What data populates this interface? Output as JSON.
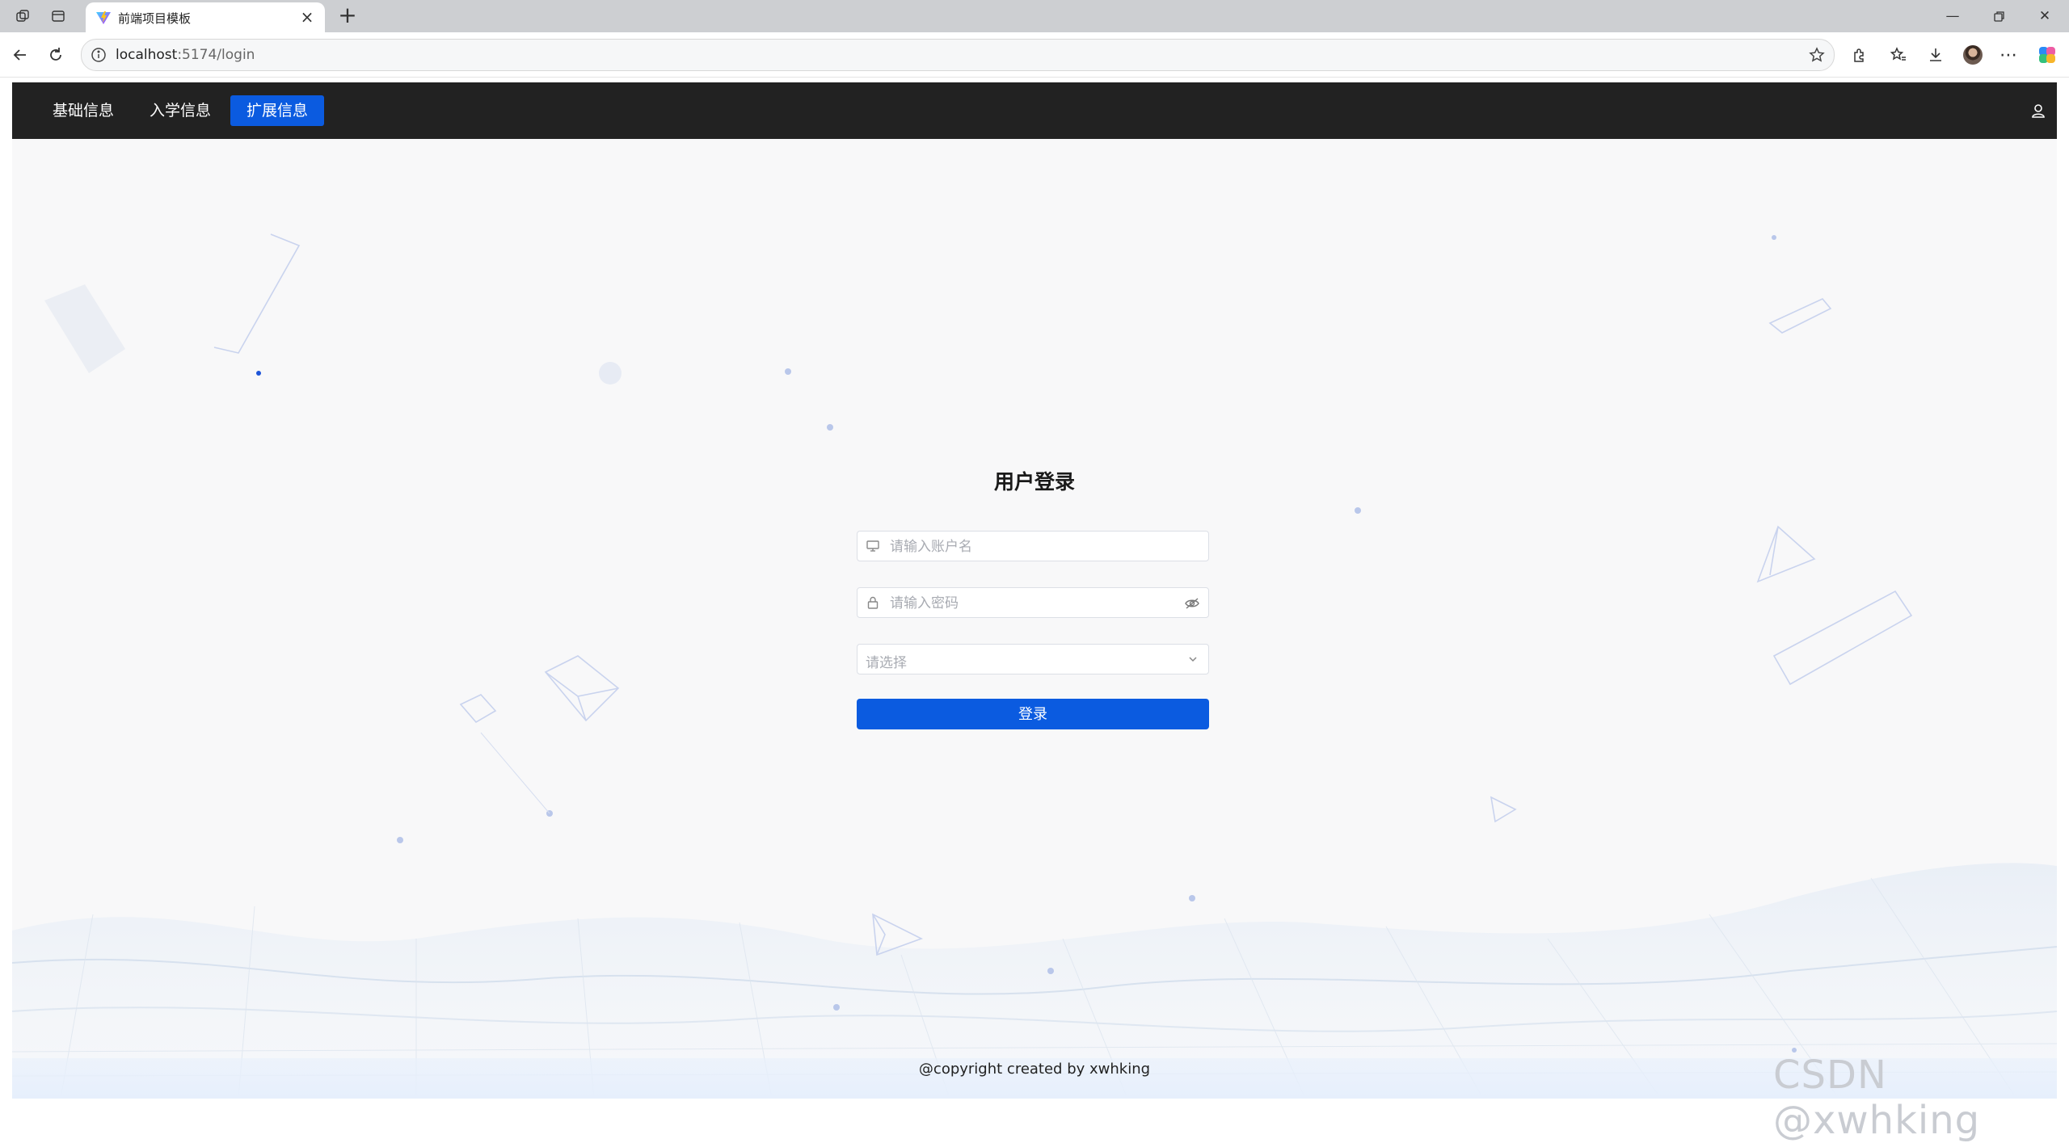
{
  "browser": {
    "tab_title": "前端项目模板",
    "url_host": "localhost",
    "url_rest": ":5174/login"
  },
  "nav": {
    "items": [
      {
        "label": "基础信息",
        "active": false
      },
      {
        "label": "入学信息",
        "active": false
      },
      {
        "label": "扩展信息",
        "active": true
      }
    ]
  },
  "login": {
    "title": "用户登录",
    "username_placeholder": "请输入账户名",
    "password_placeholder": "请输入密码",
    "select_placeholder": "请选择",
    "submit_label": "登录"
  },
  "footer": {
    "text": "@copyright created by xwhking"
  },
  "watermark": "CSDN @xwhking",
  "colors": {
    "accent": "#0b5be0",
    "header_bg": "#222222",
    "page_bg": "#f8f8f9"
  }
}
